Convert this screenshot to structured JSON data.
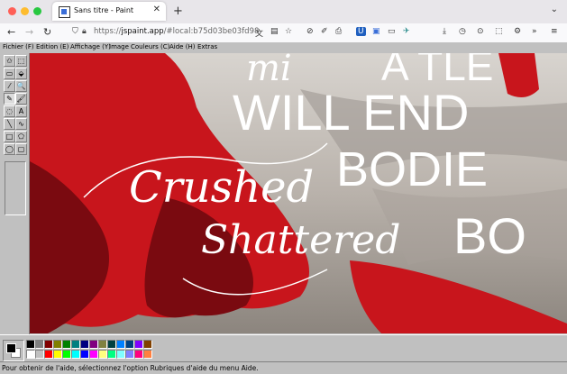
{
  "browser": {
    "tab_title": "Sans titre - Paint",
    "url_prefix": "https://",
    "url_host": "jspaint.app",
    "url_rest": "/#local:b75d03be03fd98",
    "traffic_colors": [
      "#ff5f57",
      "#febc2e",
      "#28c840"
    ]
  },
  "menu": {
    "items": [
      "Fichier (F)",
      "Edition (E)",
      "Affichage (Y)",
      "Image",
      "Couleurs (C)",
      "Aide (H)",
      "Extras"
    ]
  },
  "tools": {
    "icons": [
      "free-select-icon",
      "rect-select-icon",
      "eraser-icon",
      "fill-icon",
      "eyedropper-icon",
      "magnifier-icon",
      "pencil-icon",
      "brush-icon",
      "airbrush-icon",
      "text-icon",
      "line-icon",
      "curve-icon",
      "rectangle-icon",
      "polygon-icon",
      "ellipse-icon",
      "rounded-rect-icon"
    ],
    "glyphs": [
      "✩",
      "⬚",
      "▭",
      "⬙",
      "⁄",
      "🔍",
      "✎",
      "🖌",
      "◌",
      "A",
      "╲",
      "∿",
      "□",
      "⬠",
      "◯",
      "▢"
    ]
  },
  "canvas": {
    "text_lines": {
      "will_end": "WILL END",
      "atle": "A TLE",
      "bodie": "BODIE",
      "bo": "BO",
      "crushed": "Crushed",
      "shattered": "Shattered",
      "mi": "mi"
    },
    "colors": {
      "dress": "#c8151c",
      "dress_shadow": "#7a0a10",
      "sand": "#c9c3bc",
      "sky": "#e4e2df",
      "text": "#ffffff"
    }
  },
  "palette": {
    "foreground": "#000000",
    "background": "#ffffff",
    "colors": [
      [
        "#000000",
        "#808080",
        "#800000",
        "#808000",
        "#008000",
        "#008080",
        "#000080",
        "#800080",
        "#808040",
        "#004040",
        "#0080ff",
        "#004080",
        "#8000ff",
        "#804000"
      ],
      [
        "#ffffff",
        "#c0c0c0",
        "#ff0000",
        "#ffff00",
        "#00ff00",
        "#00ffff",
        "#0000ff",
        "#ff00ff",
        "#ffff80",
        "#00ff80",
        "#80ffff",
        "#8080ff",
        "#ff0080",
        "#ff8040"
      ]
    ]
  },
  "status": {
    "help_text": "Pour obtenir de l'aide, sélectionnez l'option Rubriques d'aide du menu Aide."
  }
}
